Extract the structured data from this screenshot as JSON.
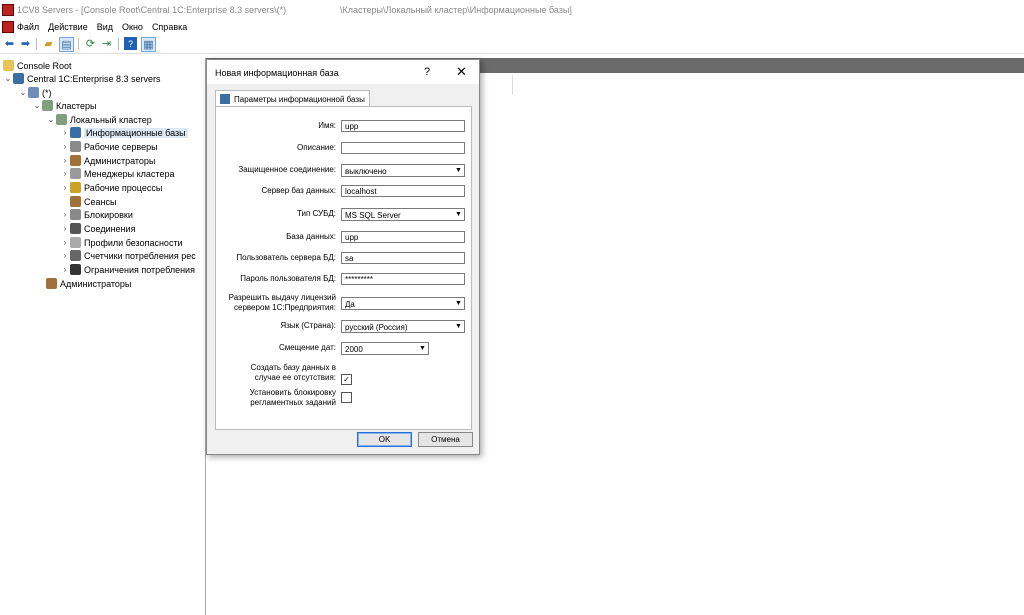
{
  "window": {
    "title": "1CV8 Servers - [Console Root\\Central 1C:Enterprise 8.3 servers\\(*)",
    "path": "\\Кластеры\\Локальный кластер\\Информационные базы]"
  },
  "menu": [
    "Файл",
    "Действие",
    "Вид",
    "Окно",
    "Справка"
  ],
  "tree": {
    "root": "Console Root",
    "servers": "Central 1C:Enterprise 8.3 servers",
    "host": "(*)",
    "clusters": "Кластеры",
    "local_cluster": "Локальный кластер",
    "items": [
      "Информационные базы",
      "Рабочие серверы",
      "Администраторы",
      "Менеджеры кластера",
      "Рабочие процессы",
      "Сеансы",
      "Блокировки",
      "Соединения",
      "Профили безопасности",
      "Счетчики потребления рес",
      "Ограничения потребления"
    ],
    "admins": "Администраторы"
  },
  "dialog": {
    "title": "Новая информационная база",
    "help": "?",
    "close": "✕",
    "tab": "Параметры информационной базы",
    "fields": {
      "name_label": "Имя:",
      "name_value": "upp",
      "desc_label": "Описание:",
      "desc_value": "",
      "secure_label": "Защищенное соединение:",
      "secure_value": "выключено",
      "dbserver_label": "Сервер баз данных:",
      "dbserver_value": "localhost",
      "dbms_label": "Тип СУБД:",
      "dbms_value": "MS SQL Server",
      "db_label": "База данных:",
      "db_value": "upp",
      "dbuser_label": "Пользователь сервера БД:",
      "dbuser_value": "sa",
      "dbpass_label": "Пароль пользователя БД:",
      "dbpass_value": "*********",
      "license_label_1": "Разрешить выдачу лицензий",
      "license_label_2": "сервером 1С:Предприятия:",
      "license_value": "Да",
      "lang_label": "Язык (Страна):",
      "lang_value": "русский (Россия)",
      "offset_label": "Смещение дат:",
      "offset_value": "2000",
      "create_label_1": "Создать базу данных в",
      "create_label_2": "случае ее отсутствия:",
      "create_checked": true,
      "block_label_1": "Установить блокировку",
      "block_label_2": "регламентных заданий",
      "block_checked": false
    },
    "ok": "OK",
    "cancel": "Отмена"
  }
}
